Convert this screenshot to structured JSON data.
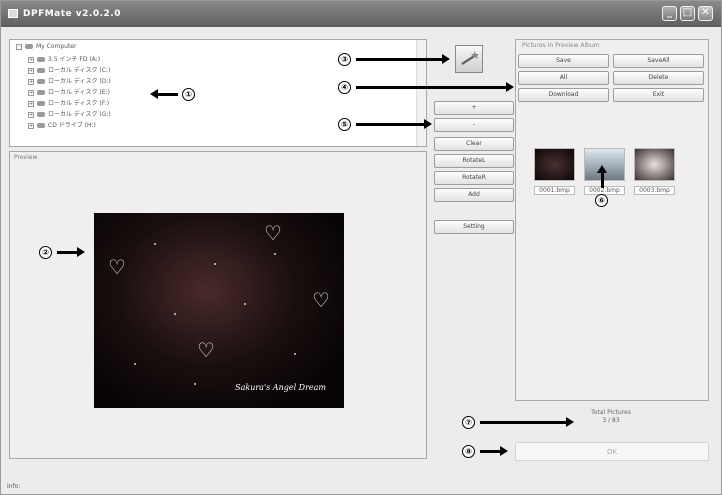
{
  "window": {
    "title": "DPFMate v2.0.2.0"
  },
  "tree": {
    "items": [
      {
        "label": "My Computer",
        "icon": "computer-icon"
      },
      {
        "label": "3.5 インチ FD (A:)",
        "icon": "floppy-icon"
      },
      {
        "label": "ローカル ディスク (C:)",
        "icon": "disk-icon"
      },
      {
        "label": "ローカル ディスク (D:)",
        "icon": "disk-icon"
      },
      {
        "label": "ローカル ディスク (E:)",
        "icon": "disk-icon"
      },
      {
        "label": "ローカル ディスク (F:)",
        "icon": "disk-icon"
      },
      {
        "label": "ローカル ディスク (G:)",
        "icon": "disk-icon"
      },
      {
        "label": "CD ドライブ (H:)",
        "icon": "cd-icon"
      }
    ]
  },
  "preview": {
    "label": "Preview",
    "photo_caption": "Sakura's Angel Dream"
  },
  "controls": {
    "zoom_in": "+",
    "zoom_out": "-",
    "clear": "Clear",
    "rotate_left": "RotateL",
    "rotate_right": "RotateR",
    "add": "Add",
    "setting": "Setting"
  },
  "album": {
    "label": "Pictures In Preview Album",
    "save": "Save",
    "save_all": "SaveAll",
    "all": "All",
    "delete": "Delete",
    "download": "Download",
    "exit": "Exit",
    "thumbnails": [
      {
        "name": "0001.bmp"
      },
      {
        "name": "0002.bmp"
      },
      {
        "name": "0003.bmp"
      }
    ]
  },
  "total": {
    "label": "Total Pictures",
    "value": "3 / 83"
  },
  "ok_label": "OK",
  "status": {
    "label": "Info:"
  },
  "callouts": [
    "①",
    "②",
    "③",
    "④",
    "⑤",
    "⑥",
    "⑦",
    "⑧"
  ]
}
